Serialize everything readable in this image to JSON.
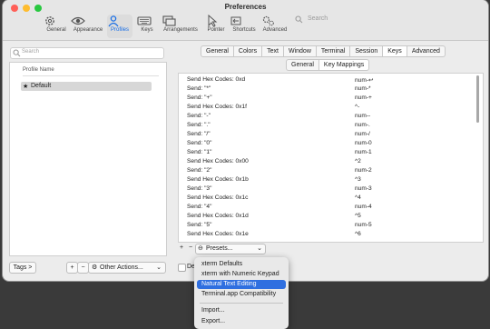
{
  "window": {
    "title": "Preferences"
  },
  "toolbar": {
    "items": [
      {
        "label": "General",
        "icon": "gear-icon"
      },
      {
        "label": "Appearance",
        "icon": "eye-icon"
      },
      {
        "label": "Profiles",
        "icon": "person-icon",
        "selected": true
      },
      {
        "label": "Keys",
        "icon": "keyboard-icon"
      },
      {
        "label": "Arrangements",
        "icon": "windows-icon"
      },
      {
        "label": "Pointer",
        "icon": "pointer-icon"
      },
      {
        "label": "Shortcuts",
        "icon": "shortcuts-icon"
      },
      {
        "label": "Advanced",
        "icon": "advanced-gear-icon"
      }
    ],
    "search_placeholder": "Search"
  },
  "sidebar": {
    "search_placeholder": "Search",
    "column_header": "Profile Name",
    "profiles": [
      {
        "name": "Default",
        "starred": true,
        "selected": true
      }
    ],
    "tags_button": "Tags >",
    "add_button": "+",
    "remove_button": "−",
    "other_actions": "Other Actions..."
  },
  "tabs": {
    "main": [
      "General",
      "Colors",
      "Text",
      "Window",
      "Terminal",
      "Session",
      "Keys",
      "Advanced"
    ],
    "main_selected": "Keys",
    "sub": [
      "General",
      "Key Mappings"
    ],
    "sub_selected": "Key Mappings"
  },
  "mappings": [
    {
      "action": "Send Hex Codes: 0xd",
      "key": "num-↩"
    },
    {
      "action": "Send: \"*\"",
      "key": "num-*"
    },
    {
      "action": "Send: \"+\"",
      "key": "num-+"
    },
    {
      "action": "Send Hex Codes: 0x1f",
      "key": "^-"
    },
    {
      "action": "Send: \"-\"",
      "key": "num--"
    },
    {
      "action": "Send: \".\"",
      "key": "num-."
    },
    {
      "action": "Send: \"/\"",
      "key": "num-/"
    },
    {
      "action": "Send: \"0\"",
      "key": "num-0"
    },
    {
      "action": "Send: \"1\"",
      "key": "num-1"
    },
    {
      "action": "Send Hex Codes: 0x00",
      "key": "^2"
    },
    {
      "action": "Send: \"2\"",
      "key": "num-2"
    },
    {
      "action": "Send Hex Codes: 0x1b",
      "key": "^3"
    },
    {
      "action": "Send: \"3\"",
      "key": "num-3"
    },
    {
      "action": "Send Hex Codes: 0x1c",
      "key": "^4"
    },
    {
      "action": "Send: \"4\"",
      "key": "num-4"
    },
    {
      "action": "Send Hex Codes: 0x1d",
      "key": "^5"
    },
    {
      "action": "Send: \"5\"",
      "key": "num-5"
    },
    {
      "action": "Send Hex Codes: 0x1e",
      "key": "^6"
    }
  ],
  "bottom": {
    "add": "+",
    "remove": "−",
    "presets": "Presets...",
    "checkbox_label_partial": "Del"
  },
  "presets_menu": {
    "items": [
      "xterm Defaults",
      "xterm with Numeric Keypad",
      "Natural Text Editing",
      "Terminal.app Compatibility"
    ],
    "highlighted": "Natural Text Editing",
    "items2": [
      "Import...",
      "Export..."
    ]
  },
  "colors": {
    "accent": "#2f6fe0",
    "selected_tab_text": "#1a6fe6"
  }
}
